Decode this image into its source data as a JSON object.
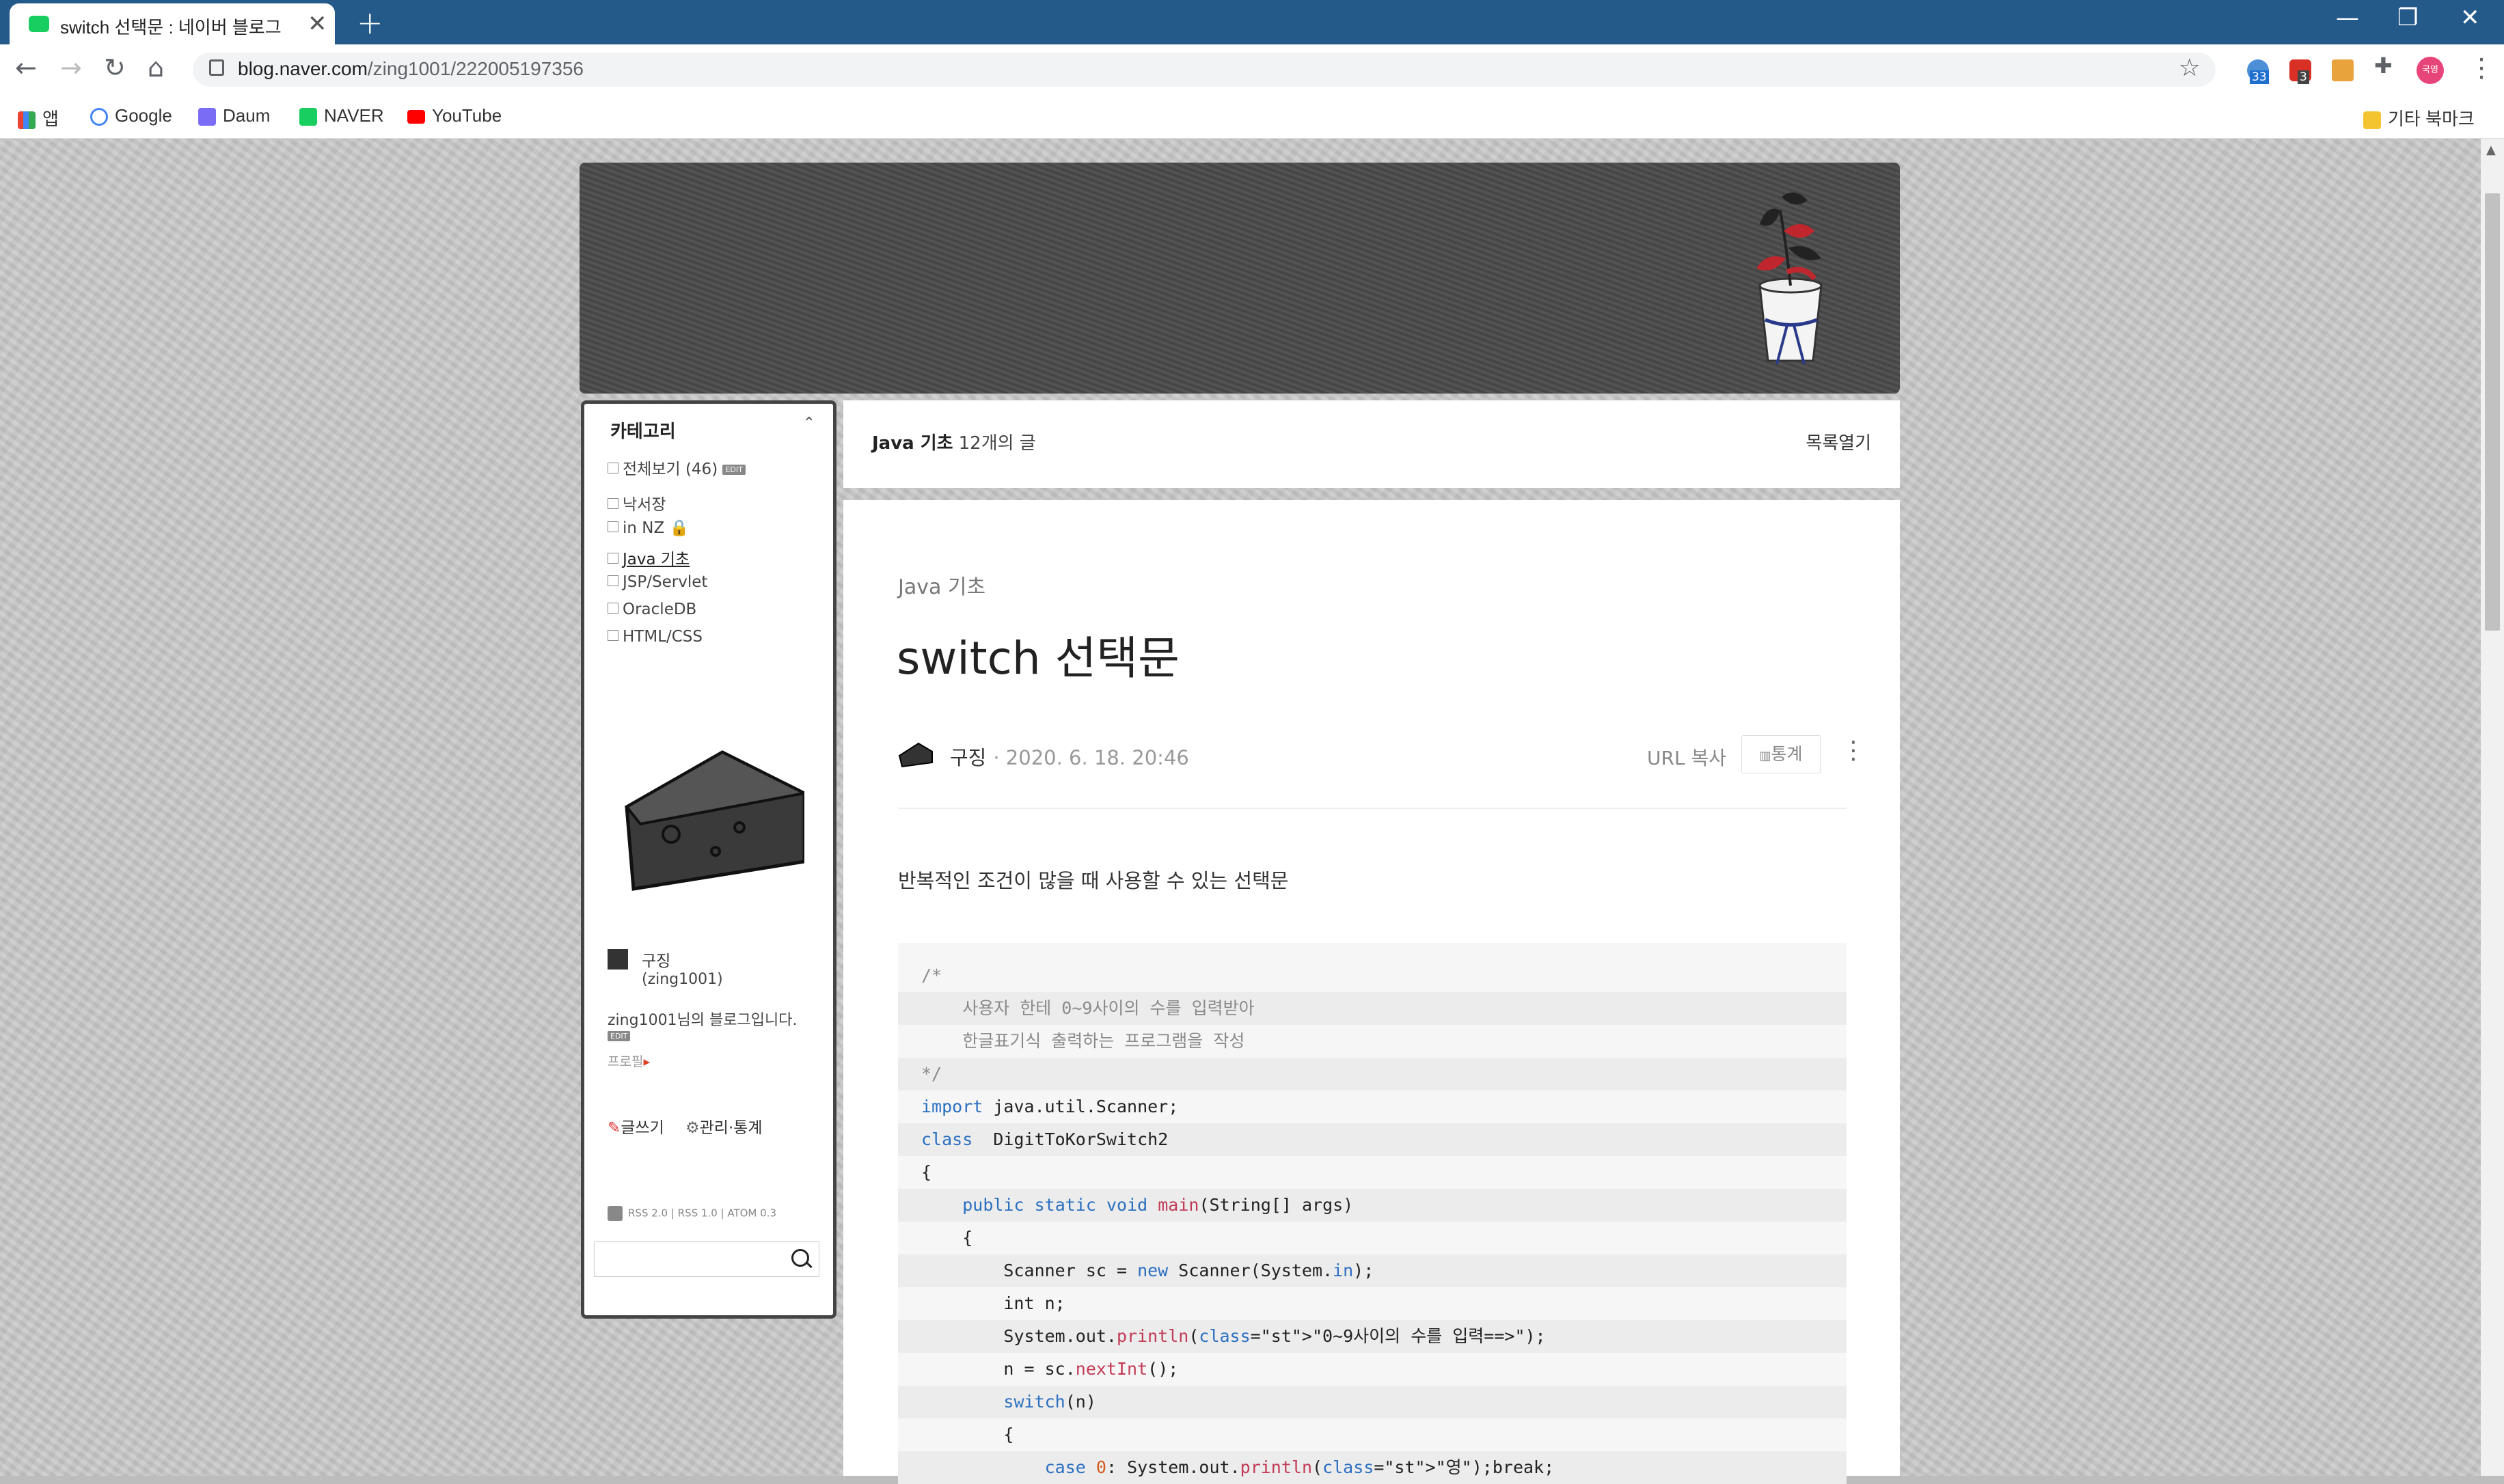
{
  "browser": {
    "tab_title": "switch 선택문 : 네이버 블로그",
    "url_host": "blog.naver.com",
    "url_path": "/zing1001/222005197356",
    "ext_badge_1": "33",
    "ext_badge_2": "3",
    "profile_label": "국영"
  },
  "bookmarks": {
    "apps": "앱",
    "items": [
      "Google",
      "Daum",
      "NAVER",
      "YouTube"
    ],
    "other": "기타 북마크"
  },
  "sidebar": {
    "title": "카테고리",
    "all": "전체보기",
    "all_count": "(46)",
    "edit": "EDIT",
    "categories": [
      "낙서장",
      "in NZ",
      "Java 기초",
      "JSP/Servlet",
      "OracleDB",
      "HTML/CSS"
    ],
    "profile_name": "구징",
    "profile_id": "(zing1001)",
    "profile_desc": "zing1001님의 블로그입니다.",
    "profile_link": "프로필",
    "write": "글쓰기",
    "manage": "관리·통계",
    "rss": "RSS 2.0  |  RSS 1.0  |  ATOM 0.3"
  },
  "listbar": {
    "category": "Java 기초",
    "count": "12개의 글",
    "open": "목록열기"
  },
  "post": {
    "category": "Java 기초",
    "title": "switch 선택문",
    "author": "구징",
    "date": "· 2020. 6. 18. 20:46",
    "url_copy": "URL 복사",
    "stats": "통계",
    "lead": "반복적인 조건이 많을 때 사용할 수 있는 선택문"
  },
  "code_lines": [
    "/*",
    "    사용자 한테 0~9사이의 수를 입력받아",
    "    한글표기식 출력하는 프로그램을 작성",
    "*/",
    "import java.util.Scanner;",
    "class  DigitToKorSwitch2",
    "{",
    "    public static void main(String[] args)",
    "    {",
    "        Scanner sc = new Scanner(System.in);",
    "        int n;",
    "        System.out.println(\"0~9사이의 수를 입력==>\");",
    "        n = sc.nextInt();",
    "        switch(n)",
    "        {",
    "            case 0: System.out.println(\"영\");break;"
  ]
}
